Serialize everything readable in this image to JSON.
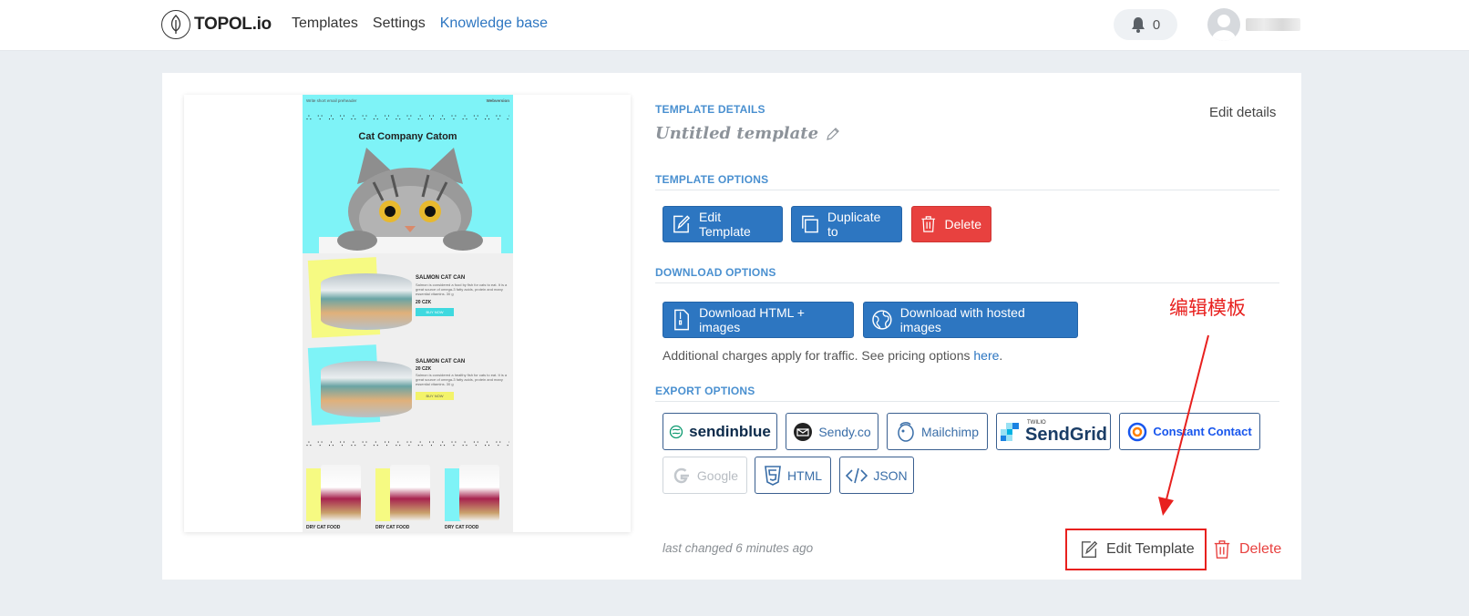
{
  "header": {
    "logo_text": "TOPOL.io",
    "nav": [
      "Templates",
      "Settings",
      "Knowledge base"
    ],
    "notification_count": "0"
  },
  "preview": {
    "top_left_text": "Write short email preheader",
    "top_right_text": "Webversion",
    "brand": "Cat Company Catom",
    "products": [
      {
        "title": "SALMON CAT CAN",
        "text": "Salmon is considered a food by fish for cats to eat. It is a great source of omega-3 fatty acids, protein and many essential vitamins. 30 g",
        "price": "20 CZK",
        "button": "BUY NOW"
      },
      {
        "title": "SALMON CAT CAN",
        "text": "Salmon is considered a healthy fish for cats to eat. It is a great source of omega-3 fatty acids, protein and many essential vitamins. 30 g",
        "price": "20 CZK",
        "button": "BUY NOW"
      }
    ],
    "bag_titles": [
      "DRY CAT FOOD",
      "DRY CAT FOOD",
      "DRY CAT FOOD"
    ]
  },
  "details": {
    "section_label": "TEMPLATE DETAILS",
    "name": "Untitled template",
    "edit_details": "Edit details"
  },
  "template_options": {
    "section_label": "TEMPLATE OPTIONS",
    "edit": "Edit Template",
    "duplicate": "Duplicate to",
    "delete": "Delete"
  },
  "download_options": {
    "section_label": "DOWNLOAD OPTIONS",
    "html_images": "Download HTML + images",
    "hosted": "Download with hosted images",
    "note": "Additional charges apply for traffic. See pricing options ",
    "note_link": "here",
    "note_end": "."
  },
  "export_options": {
    "section_label": "EXPORT OPTIONS",
    "sendinblue": "sendinblue",
    "sendy": "Sendy.co",
    "mailchimp": "Mailchimp",
    "sendgrid_small": "TWILIO",
    "sendgrid": "SendGrid",
    "constant_contact": "Constant Contact",
    "google": "Google",
    "html": "HTML",
    "json": "JSON"
  },
  "footer": {
    "last_changed": "last changed 6 minutes ago",
    "edit": "Edit Template",
    "delete": "Delete"
  },
  "annotation": {
    "text": "编辑模板",
    "color": "#e8201e"
  },
  "colors": {
    "primary": "#2d76c1",
    "danger": "#e8413f",
    "label": "#4a90d0"
  }
}
